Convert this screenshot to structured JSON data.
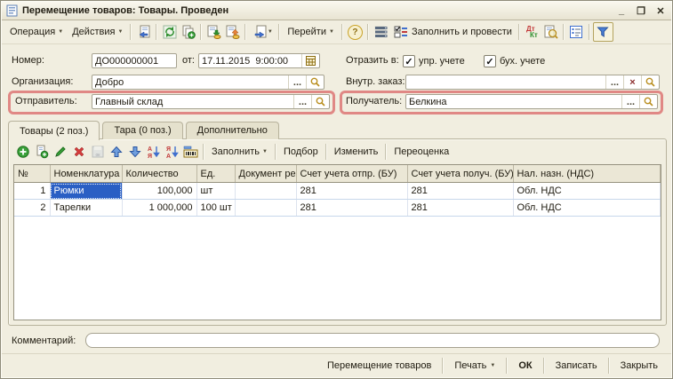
{
  "ui": {
    "caret": "▼",
    "ellipsis": "...",
    "clear": "×",
    "check": "✓",
    "help": "?",
    "minimize": "_",
    "maximize": "❐",
    "close": "✕",
    "dt": "Дт",
    "kt": "Кт",
    "sort_a": "А",
    "sort_ya": "Я",
    "arrow_down": "↓"
  },
  "colors": {
    "annotation_highlight": "#e08885",
    "selection_blue": "#2a5fc4",
    "window_background": "#f1eee0"
  },
  "window": {
    "title": "Перемещение товаров: Товары. Проведен"
  },
  "toolbar": {
    "operation": "Операция",
    "actions": "Действия",
    "goto": "Перейти",
    "fill_and_post": "Заполнить и провести"
  },
  "form": {
    "number": {
      "label": "Номер:",
      "value": "ДО000000001"
    },
    "date": {
      "label": "от:",
      "value": "17.11.2015  9:00:00"
    },
    "reflect": {
      "label": "Отразить в:",
      "cb1": {
        "label": "упр. учете",
        "checked": true
      },
      "cb2": {
        "label": "бух. учете",
        "checked": true
      }
    },
    "organization": {
      "label": "Организация:",
      "value": "Добро"
    },
    "internal_order": {
      "label": "Внутр. заказ:",
      "value": ""
    },
    "sender": {
      "label": "Отправитель:",
      "value": "Главный склад"
    },
    "receiver": {
      "label": "Получатель:",
      "value": "Белкина"
    }
  },
  "tabs": [
    {
      "label": "Товары (2 поз.)"
    },
    {
      "label": "Тара (0 поз.)"
    },
    {
      "label": "Дополнительно"
    }
  ],
  "ttoolbar": {
    "fill": "Заполнить",
    "pick": "Подбор",
    "change": "Изменить",
    "revaluation": "Переоценка"
  },
  "table": {
    "columns": [
      "№",
      "Номенклатура",
      "Количество",
      "Ед.",
      "Документ ре...",
      "Счет учета отпр. (БУ)",
      "Счет учета получ. (БУ)",
      "Нал. назн. (НДС)"
    ],
    "rows": [
      [
        "1",
        "Рюмки",
        "100,000",
        "шт",
        "",
        "281",
        "281",
        "Обл. НДС"
      ],
      [
        "2",
        "Тарелки",
        "1 000,000",
        "100 шт",
        "",
        "281",
        "281",
        "Обл. НДС"
      ]
    ]
  },
  "comment": {
    "label": "Комментарий:",
    "value": ""
  },
  "footer": {
    "transfer": "Перемещение товаров",
    "print": "Печать",
    "ok": "ОК",
    "save": "Записать",
    "close": "Закрыть"
  }
}
